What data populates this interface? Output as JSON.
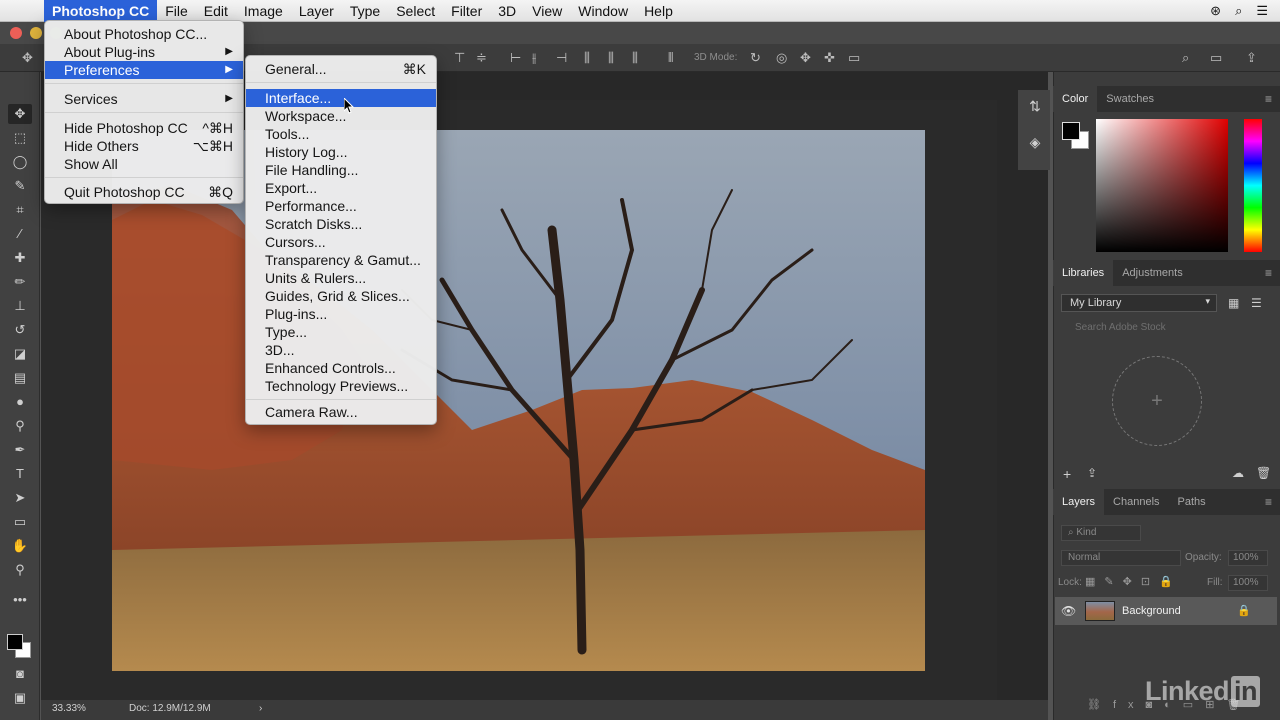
{
  "menubar": {
    "app_name": "Photoshop CC",
    "items": [
      "File",
      "Edit",
      "Image",
      "Layer",
      "Type",
      "Select",
      "Filter",
      "3D",
      "View",
      "Window",
      "Help"
    ]
  },
  "app_menu": {
    "about_photoshop": "About Photoshop CC...",
    "about_plugins": "About Plug-ins",
    "preferences": "Preferences",
    "services": "Services",
    "hide_photoshop": "Hide Photoshop CC",
    "hide_photoshop_sc": "^⌘H",
    "hide_others": "Hide Others",
    "hide_others_sc": "⌥⌘H",
    "show_all": "Show All",
    "quit": "Quit Photoshop CC",
    "quit_sc": "⌘Q"
  },
  "preferences_menu": {
    "general": "General...",
    "general_sc": "⌘K",
    "items": [
      "Interface...",
      "Workspace...",
      "Tools...",
      "History Log...",
      "File Handling...",
      "Export...",
      "Performance...",
      "Scratch Disks...",
      "Cursors...",
      "Transparency & Gamut...",
      "Units & Rulers...",
      "Guides, Grid & Slices...",
      "Plug-ins...",
      "Type...",
      "3D...",
      "Enhanced Controls...",
      "Technology Previews..."
    ],
    "camera_raw": "Camera Raw..."
  },
  "optbar": {
    "mode_3d": "3D Mode:"
  },
  "statusbar": {
    "zoom": "33.33%",
    "doc": "Doc: 12.9M/12.9M"
  },
  "color_panel": {
    "tabs": [
      "Color",
      "Swatches"
    ]
  },
  "libraries_panel": {
    "tabs": [
      "Libraries",
      "Adjustments"
    ],
    "library": "My Library",
    "search_placeholder": "Search Adobe Stock"
  },
  "layers_panel": {
    "tabs": [
      "Layers",
      "Channels",
      "Paths"
    ],
    "kind": "Kind",
    "blend": "Normal",
    "opacity_label": "Opacity:",
    "opacity": "100%",
    "lock_label": "Lock:",
    "fill_label": "Fill:",
    "fill": "100%",
    "layer_name": "Background"
  },
  "watermark": {
    "text": "Linked",
    "in": "in"
  }
}
